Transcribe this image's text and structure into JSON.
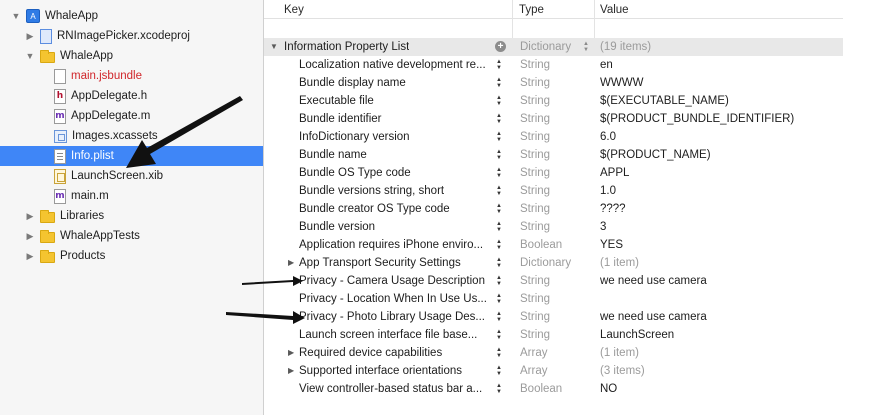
{
  "navigator": {
    "items": [
      {
        "label": "WhaleApp",
        "icon": "project-icon",
        "disclosure": "expanded",
        "selected": false
      },
      {
        "label": "RNImagePicker.xcodeproj",
        "icon": "xcodeproj-icon",
        "disclosure": "collapsed",
        "selected": false
      },
      {
        "label": "WhaleApp",
        "icon": "folder-icon",
        "disclosure": "expanded",
        "selected": false
      },
      {
        "label": "main.jsbundle",
        "icon": "file-icon",
        "disclosure": "none",
        "selected": false,
        "missing": true
      },
      {
        "label": "AppDelegate.h",
        "icon": "header-file-icon",
        "glyph": "h",
        "disclosure": "none",
        "selected": false
      },
      {
        "label": "AppDelegate.m",
        "icon": "implementation-file-icon",
        "glyph": "m",
        "disclosure": "none",
        "selected": false
      },
      {
        "label": "Images.xcassets",
        "icon": "asset-catalog-icon",
        "disclosure": "none",
        "selected": false
      },
      {
        "label": "Info.plist",
        "icon": "plist-file-icon",
        "disclosure": "none",
        "selected": true
      },
      {
        "label": "LaunchScreen.xib",
        "icon": "xib-file-icon",
        "disclosure": "none",
        "selected": false
      },
      {
        "label": "main.m",
        "icon": "implementation-file-icon",
        "glyph": "m",
        "disclosure": "none",
        "selected": false
      },
      {
        "label": "Libraries",
        "icon": "folder-icon",
        "disclosure": "collapsed",
        "selected": false
      },
      {
        "label": "WhaleAppTests",
        "icon": "folder-icon",
        "disclosure": "collapsed",
        "selected": false
      },
      {
        "label": "Products",
        "icon": "folder-icon",
        "disclosure": "collapsed",
        "selected": false
      }
    ]
  },
  "plist": {
    "headers": {
      "key": "Key",
      "type": "Type",
      "value": "Value"
    },
    "root": {
      "key": "Information Property List",
      "type": "Dictionary",
      "value": "(19 items)"
    },
    "rows": [
      {
        "key": "Localization native development re...",
        "type": "String",
        "value": "en",
        "expandable": false
      },
      {
        "key": "Bundle display name",
        "type": "String",
        "value": "WWWW",
        "expandable": false
      },
      {
        "key": "Executable file",
        "type": "String",
        "value": "$(EXECUTABLE_NAME)",
        "expandable": false
      },
      {
        "key": "Bundle identifier",
        "type": "String",
        "value": "$(PRODUCT_BUNDLE_IDENTIFIER)",
        "expandable": false
      },
      {
        "key": "InfoDictionary version",
        "type": "String",
        "value": "6.0",
        "expandable": false
      },
      {
        "key": "Bundle name",
        "type": "String",
        "value": "$(PRODUCT_NAME)",
        "expandable": false
      },
      {
        "key": "Bundle OS Type code",
        "type": "String",
        "value": "APPL",
        "expandable": false
      },
      {
        "key": "Bundle versions string, short",
        "type": "String",
        "value": "1.0",
        "expandable": false
      },
      {
        "key": "Bundle creator OS Type code",
        "type": "String",
        "value": "????",
        "expandable": false
      },
      {
        "key": "Bundle version",
        "type": "String",
        "value": "3",
        "expandable": false
      },
      {
        "key": "Application requires iPhone enviro...",
        "type": "Boolean",
        "value": "YES",
        "expandable": false
      },
      {
        "key": "App Transport Security Settings",
        "type": "Dictionary",
        "value": "(1 item)",
        "expandable": true
      },
      {
        "key": "Privacy - Camera Usage Description",
        "type": "String",
        "value": "we need use camera",
        "expandable": false
      },
      {
        "key": "Privacy - Location When In Use Us...",
        "type": "String",
        "value": "",
        "expandable": false
      },
      {
        "key": "Privacy - Photo Library Usage Des...",
        "type": "String",
        "value": "we need use camera",
        "expandable": false
      },
      {
        "key": "Launch screen interface file base...",
        "type": "String",
        "value": "LaunchScreen",
        "expandable": false
      },
      {
        "key": "Required device capabilities",
        "type": "Array",
        "value": "(1 item)",
        "expandable": true
      },
      {
        "key": "Supported interface orientations",
        "type": "Array",
        "value": "(3 items)",
        "expandable": true
      },
      {
        "key": "View controller-based status bar a...",
        "type": "Boolean",
        "value": "NO",
        "expandable": false
      }
    ]
  },
  "colors": {
    "selection": "#3f86f7",
    "missing_file": "#d0262b",
    "annotation_arrow": "#111111"
  }
}
